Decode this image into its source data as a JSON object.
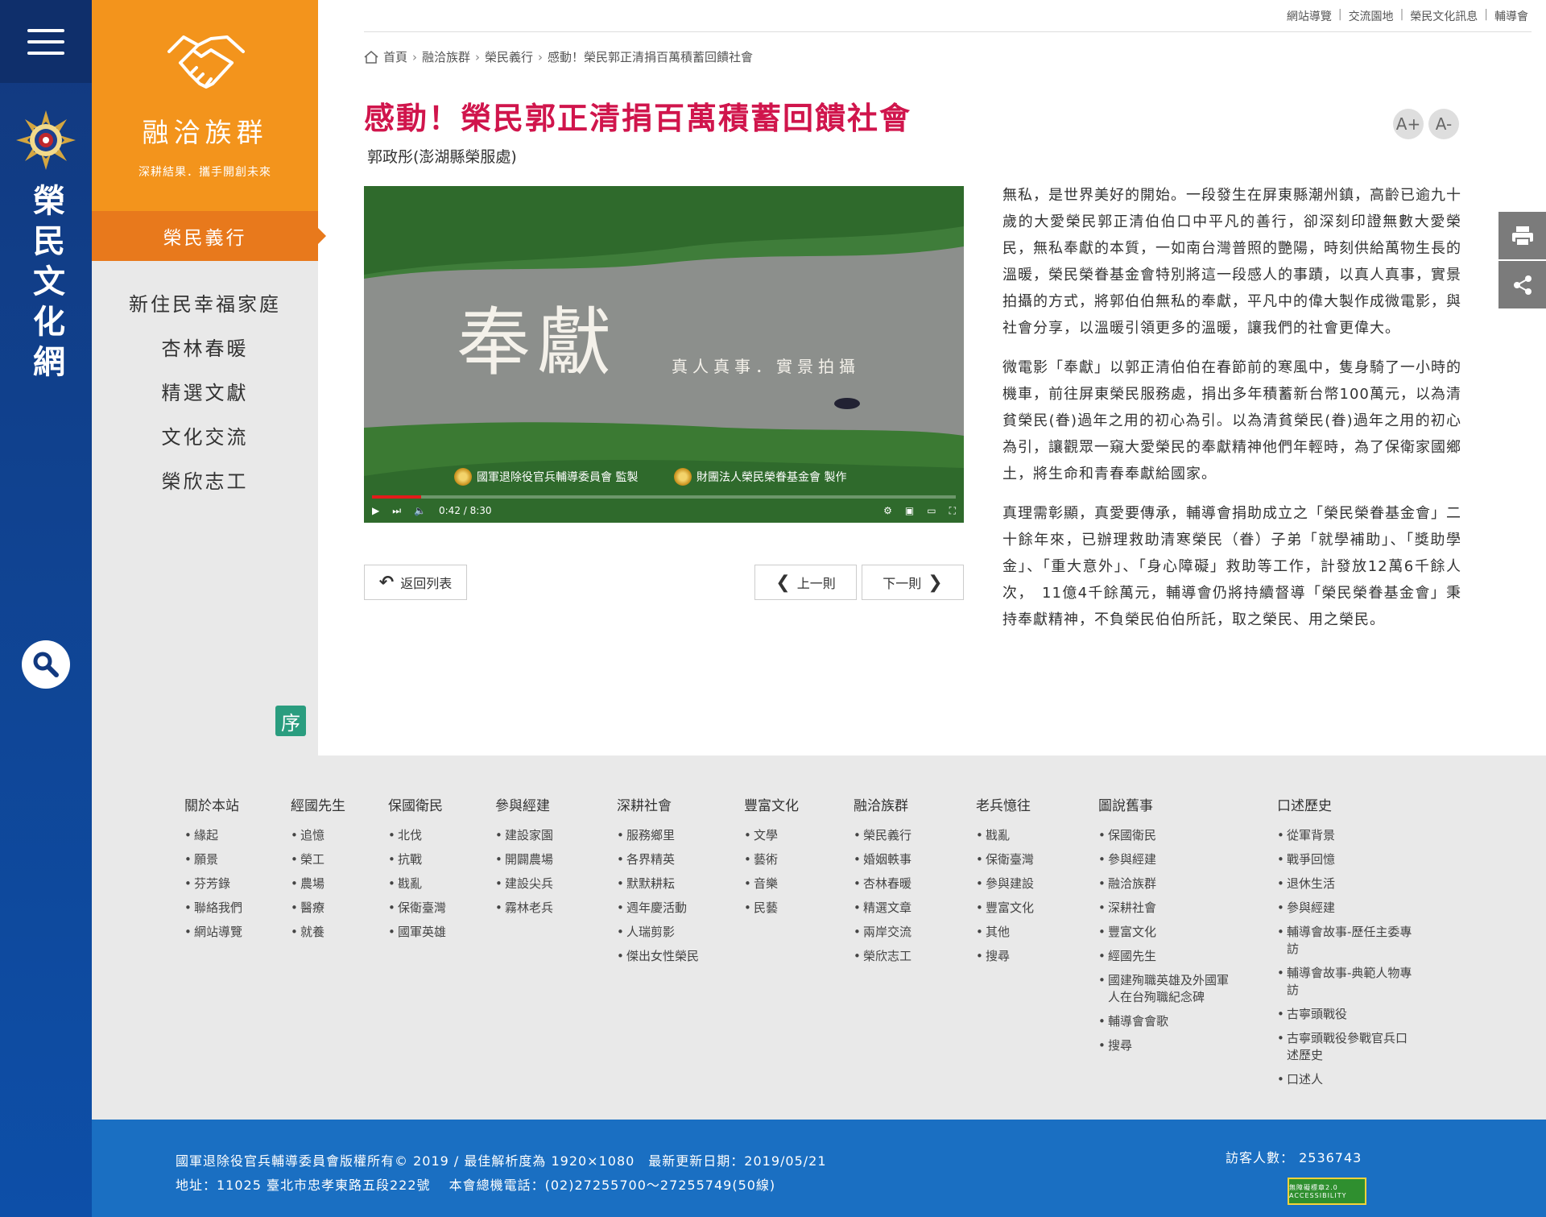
{
  "top_links": [
    "網站導覽",
    "交流園地",
    "榮民文化訊息",
    "輔導會"
  ],
  "site_title_vertical": "榮民文化網",
  "sidebar": {
    "brand_title": "融洽族群",
    "brand_sub": "深耕結果．攜手開創未來",
    "active": "榮民義行",
    "items": [
      "新住民幸福家庭",
      "杏林春暖",
      "精選文獻",
      "文化交流",
      "榮欣志工"
    ],
    "seal": "序"
  },
  "breadcrumb": [
    "首頁",
    "融洽族群",
    "榮民義行",
    "感動！榮民郭正清捐百萬積蓄回饋社會"
  ],
  "article": {
    "title": "感動！榮民郭正清捐百萬積蓄回饋社會",
    "author": "郭政彤(澎湖縣榮服處)",
    "font_inc": "A+",
    "font_dec": "A-",
    "paragraphs": [
      "無私，是世界美好的開始。一段發生在屏東縣潮州鎮，高齡已逾九十歲的大愛榮民郭正清伯伯口中平凡的善行，卻深刻印證無數大愛榮民，無私奉獻的本質，一如南台灣普照的艷陽，時刻供給萬物生長的溫暖，榮民榮眷基金會特別將這一段感人的事蹟，以真人真事，實景拍攝的方式，將郭伯伯無私的奉獻，平凡中的偉大製作成微電影，與社會分享，以溫暖引領更多的溫暖，讓我們的社會更偉大。",
      "微電影「奉獻」以郭正清伯伯在春節前的寒風中，隻身騎了一小時的機車，前往屏東榮民服務處，捐出多年積蓄新台幣100萬元，以為清貧榮民(眷)過年之用的初心為引。以為清貧榮民(眷)過年之用的初心為引，讓觀眾一窺大愛榮民的奉獻精神他們年輕時，為了保衛家國鄉土，將生命和青春奉獻給國家。",
      "真理需彰顯，真愛要傳承，輔導會捐助成立之「榮民榮眷基金會」二十餘年來，已辦理救助清寒榮民（眷）子弟「就學補助」、「獎助學金」、「重大意外」、「身心障礙」救助等工作，計發放12萬6千餘人次，　11億4千餘萬元，輔導會仍將持續督導「榮民榮眷基金會」秉持奉獻精神，不負榮民伯伯所託，取之榮民、用之榮民。"
    ]
  },
  "video": {
    "title_big": "奉獻",
    "title_sub": "真人真事．實景拍攝",
    "credit_1": "國軍退除役官兵輔導委員會 監製",
    "credit_2": "財團法人榮民榮眷基金會 製作",
    "time": "0:42 / 8:30",
    "progress": 0.084
  },
  "buttons": {
    "back": "返回列表",
    "prev": "上一則",
    "next": "下一則"
  },
  "footer_columns": [
    {
      "title": "關於本站",
      "items": [
        "緣起",
        "願景",
        "芬芳錄",
        "聯絡我們",
        "網站導覽"
      ]
    },
    {
      "title": "經國先生",
      "items": [
        "追憶",
        "榮工",
        "農場",
        "醫療",
        "就養"
      ]
    },
    {
      "title": "保國衛民",
      "items": [
        "北伐",
        "抗戰",
        "戡亂",
        "保衛臺灣",
        "國軍英雄"
      ]
    },
    {
      "title": "參與經建",
      "items": [
        "建設家園",
        "開闢農場",
        "建設尖兵",
        "霧林老兵"
      ]
    },
    {
      "title": "深耕社會",
      "items": [
        "服務鄉里",
        "各界精英",
        "默默耕耘",
        "週年慶活動",
        "人瑞剪影",
        "傑出女性榮民"
      ]
    },
    {
      "title": "豐富文化",
      "items": [
        "文學",
        "藝術",
        "音樂",
        "民藝"
      ]
    },
    {
      "title": "融洽族群",
      "items": [
        "榮民義行",
        "婚姻軼事",
        "杏林春暖",
        "精選文章",
        "兩岸交流",
        "榮欣志工"
      ]
    },
    {
      "title": "老兵憶往",
      "items": [
        "戡亂",
        "保衛臺灣",
        "參與建設",
        "豐富文化",
        "其他",
        "搜尋"
      ]
    },
    {
      "title": "圖說舊事",
      "items": [
        "保國衛民",
        "參與經建",
        "融洽族群",
        "深耕社會",
        "豐富文化",
        "經國先生",
        "國建殉職英雄及外國軍人在台殉職紀念碑",
        "輔導會會歌",
        "搜尋"
      ]
    },
    {
      "title": "口述歷史",
      "items": [
        "從軍背景",
        "戰爭回憶",
        "退休生活",
        "參與經建",
        "輔導會故事-歷任主委專訪",
        "輔導會故事-典範人物專訪",
        "古寧頭戰役",
        "古寧頭戰役參戰官兵口述歷史",
        "口述人"
      ]
    }
  ],
  "footer": {
    "line1": "國軍退除役官兵輔導委員會版權所有© 2019 / 最佳解析度為 1920×1080　最新更新日期：2019/05/21",
    "line2": "地址：11025 臺北市忠孝東路五段222號　 本會總機電話：(02)27255700～27255749(50線)",
    "visits": "訪客人數： 2536743",
    "badge": "無障礙標章2.0 ACCESSIBILITY"
  }
}
